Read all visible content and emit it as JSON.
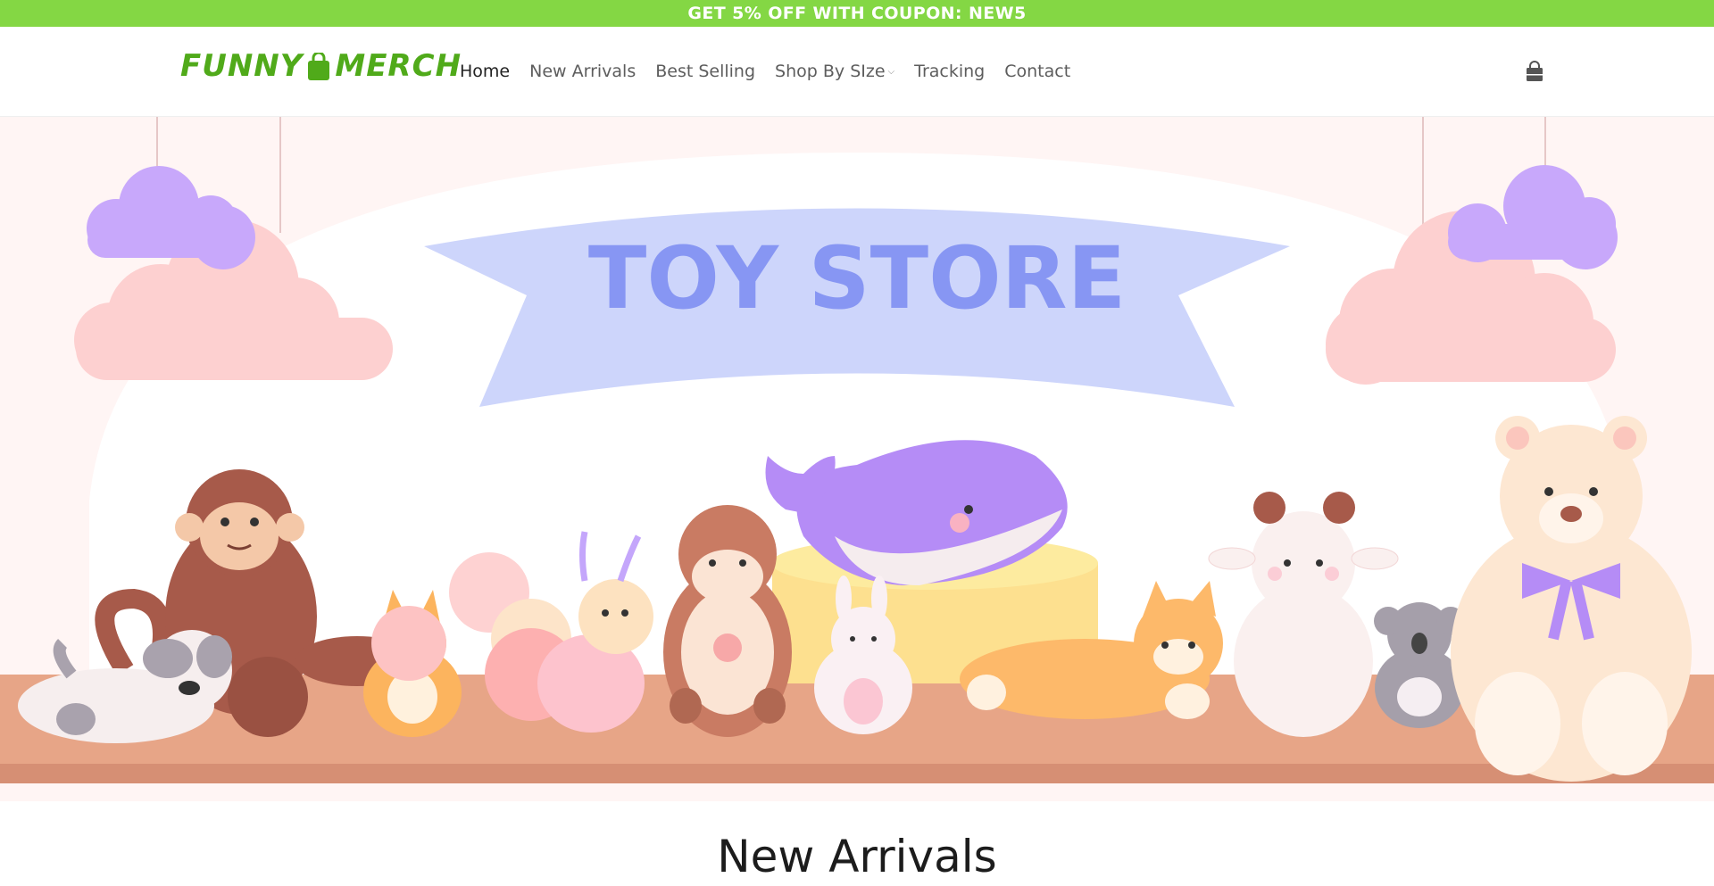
{
  "announcement": {
    "text": "GET 5% OFF WITH COUPON: NEW5"
  },
  "brand": {
    "part1": "FUNNY",
    "part2": "MERCH",
    "color": "#50aa1a"
  },
  "nav": {
    "items": [
      {
        "label": "Home",
        "active": true
      },
      {
        "label": "New Arrivals"
      },
      {
        "label": "Best Selling"
      },
      {
        "label": "Shop By SIze",
        "dropdown": true
      },
      {
        "label": "Tracking"
      },
      {
        "label": "Contact"
      }
    ]
  },
  "header": {
    "cart_icon": "shopping-bag-icon"
  },
  "hero": {
    "banner_text": "TOY STORE"
  },
  "section": {
    "title": "New Arrivals"
  },
  "colors": {
    "announce_bg": "#84d744",
    "banner": "#cdd5fb",
    "banner_text": "#8796f3",
    "shelf": "#e7a587"
  }
}
